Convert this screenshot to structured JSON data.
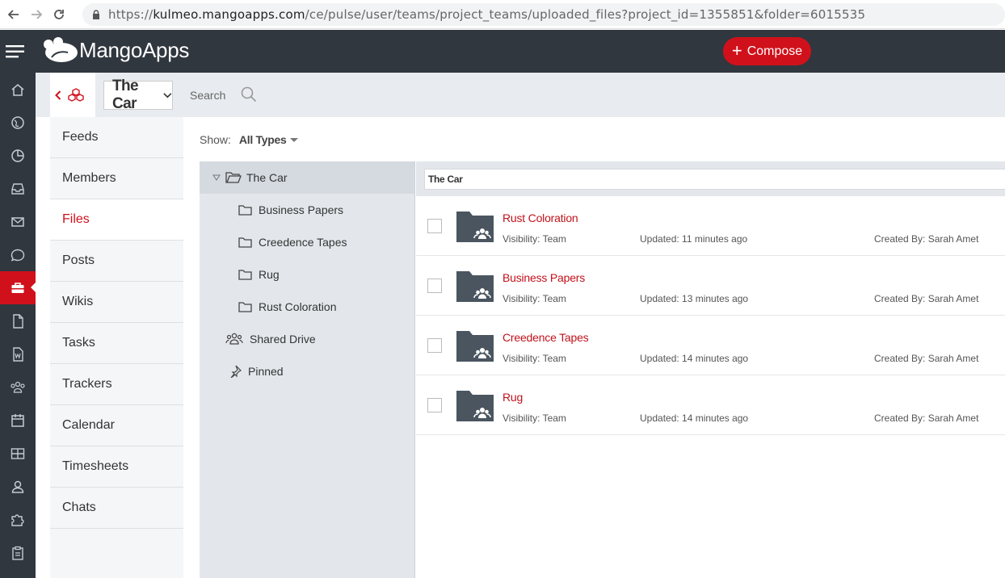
{
  "browser": {
    "url_prefix": "https://",
    "url_host": "kulmeo.mangoapps.com",
    "url_path": "/ce/pulse/user/teams/project_teams/uploaded_files?project_id=1355851&folder=6015535"
  },
  "header": {
    "logo_text": "MangoApps",
    "compose_label": "Compose"
  },
  "rail_icons": [
    "home-icon",
    "globe-icon",
    "pie-chart-icon",
    "inbox-icon",
    "mail-icon",
    "chat-bubble-icon",
    "briefcase-icon",
    "document-icon",
    "word-doc-icon",
    "people-icon",
    "calendar-icon",
    "grid-icon",
    "user-icon",
    "puzzle-icon",
    "clipboard-icon"
  ],
  "subbar": {
    "team_name": "The Car",
    "search_label": "Search"
  },
  "sidenav": {
    "items": [
      {
        "label": "Feeds"
      },
      {
        "label": "Members"
      },
      {
        "label": "Files"
      },
      {
        "label": "Posts"
      },
      {
        "label": "Wikis"
      },
      {
        "label": "Tasks"
      },
      {
        "label": "Trackers"
      },
      {
        "label": "Calendar"
      },
      {
        "label": "Timesheets"
      },
      {
        "label": "Chats"
      }
    ],
    "active": "Files"
  },
  "filter": {
    "show_label": "Show:",
    "show_value": "All Types"
  },
  "tree": {
    "root": "The Car",
    "folders": [
      "Business Papers",
      "Creedence Tapes",
      "Rug",
      "Rust Coloration"
    ],
    "shared_drive": "Shared Drive",
    "pinned": "Pinned"
  },
  "list": {
    "breadcrumb": "The Car",
    "rows": [
      {
        "name": "Rust Coloration",
        "visibility": "Visibility: Team",
        "updated": "Updated: 11 minutes ago",
        "created_by": "Created By: Sarah Amet"
      },
      {
        "name": "Business Papers",
        "visibility": "Visibility: Team",
        "updated": "Updated: 13 minutes ago",
        "created_by": "Created By: Sarah Amet"
      },
      {
        "name": "Creedence Tapes",
        "visibility": "Visibility: Team",
        "updated": "Updated: 14 minutes ago",
        "created_by": "Created By: Sarah Amet"
      },
      {
        "name": "Rug",
        "visibility": "Visibility: Team",
        "updated": "Updated: 14 minutes ago",
        "created_by": "Created By: Sarah Amet"
      }
    ]
  },
  "colors": {
    "accent": "#d0111b",
    "topbar": "#30373f"
  }
}
